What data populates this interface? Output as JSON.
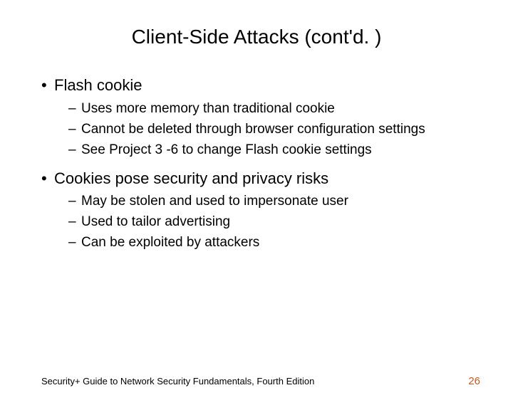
{
  "title": "Client-Side Attacks (cont'd. )",
  "bullets": [
    {
      "text": "Flash cookie",
      "sub": [
        "Uses more memory than traditional cookie",
        "Cannot be deleted through browser configuration settings",
        "See Project 3 -6 to change Flash cookie settings"
      ]
    },
    {
      "text": "Cookies pose security and privacy risks",
      "sub": [
        "May be stolen and used to impersonate user",
        "Used to tailor advertising",
        "Can be exploited by attackers"
      ]
    }
  ],
  "footer_text": "Security+ Guide to Network Security Fundamentals, Fourth Edition",
  "page_number": "26"
}
